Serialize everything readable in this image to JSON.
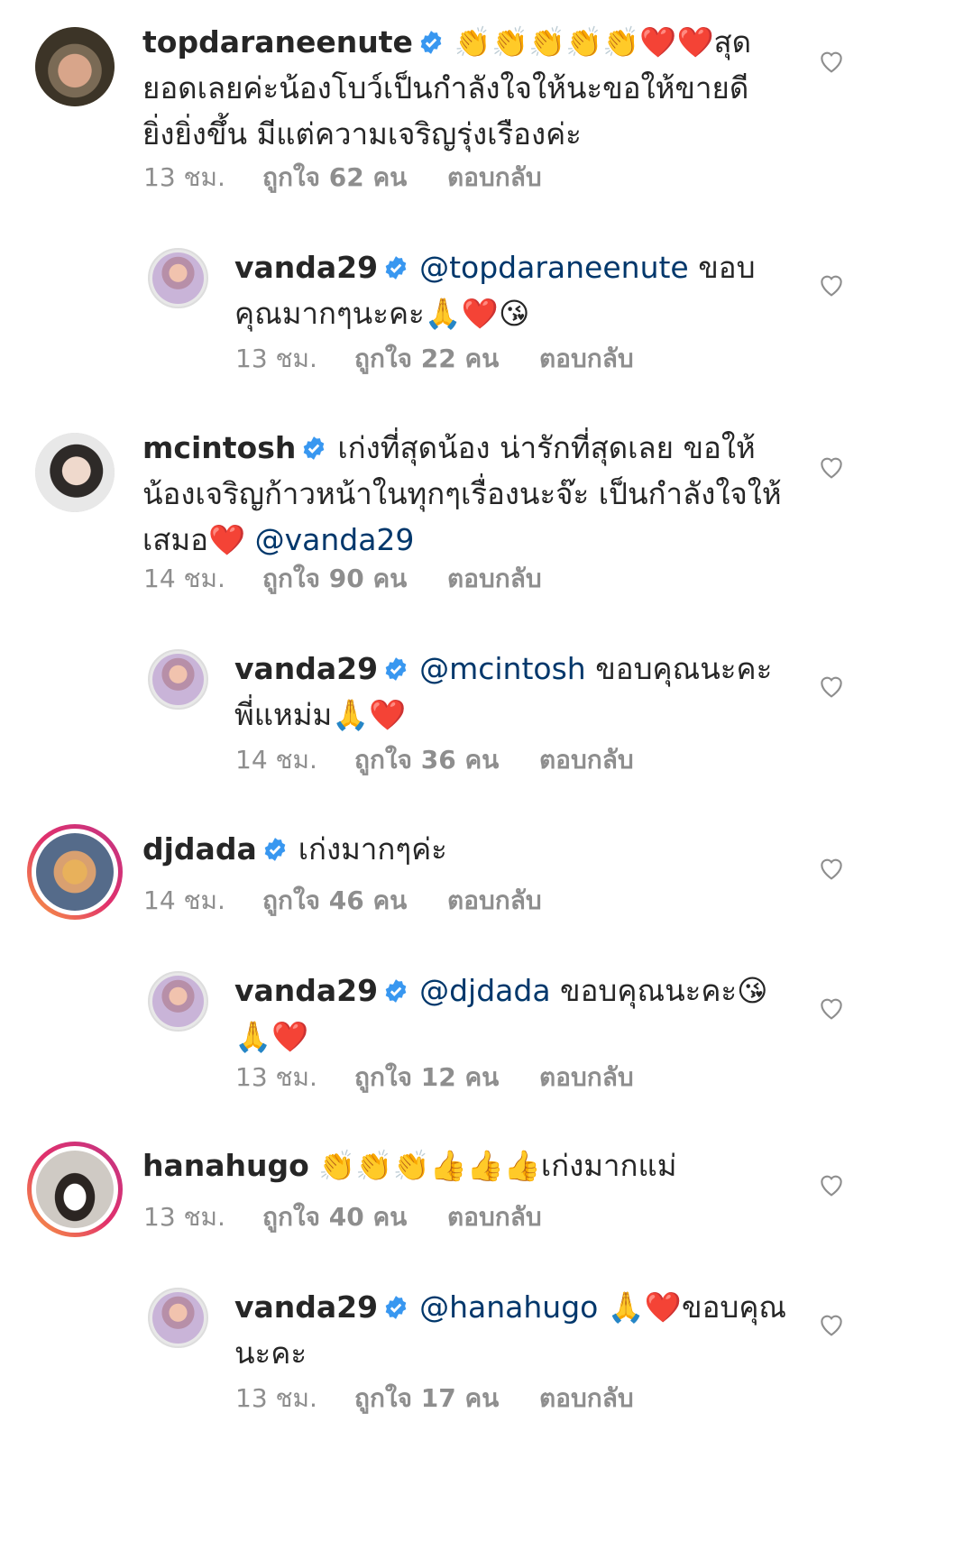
{
  "comments": [
    {
      "username": "topdaraneenute",
      "verified": true,
      "mention": "",
      "text": "👏👏👏👏👏❤️❤️สุดยอดเลยค่ะน้องโบว์เป็นกำลังใจให้นะขอให้ขายดียิ่งยิ่งขึ้น มีแต่ความเจริญรุ่งเรืองค่ะ",
      "time": "13 ชม.",
      "likes": "ถูกใจ 62 คน",
      "reply_label": "ตอบกลับ",
      "is_reply": false
    },
    {
      "username": "vanda29",
      "verified": true,
      "mention": "@topdaraneenute",
      "text": " ขอบคุณมากๆนะคะ🙏❤️😘",
      "time": "13 ชม.",
      "likes": "ถูกใจ 22 คน",
      "reply_label": "ตอบกลับ",
      "is_reply": true
    },
    {
      "username": "mcintosh",
      "verified": true,
      "mention": "",
      "text": "เก่งที่สุดน้อง น่ารักที่สุดเลย ขอให้น้องเจริญก้าวหน้าในทุกๆเรื่องนะจ๊ะ เป็นกำลังใจให้เสมอ❤️ ",
      "trailing_mention": "@vanda29",
      "time": "14 ชม.",
      "likes": "ถูกใจ 90 คน",
      "reply_label": "ตอบกลับ",
      "is_reply": false
    },
    {
      "username": "vanda29",
      "verified": true,
      "mention": "@mcintosh",
      "text": " ขอบคุณนะคะพี่แหม่ม🙏❤️",
      "time": "14 ชม.",
      "likes": "ถูกใจ 36 คน",
      "reply_label": "ตอบกลับ",
      "is_reply": true
    },
    {
      "username": "djdada",
      "verified": true,
      "mention": "",
      "text": "เก่งมากๆค่ะ",
      "time": "14 ชม.",
      "likes": "ถูกใจ 46 คน",
      "reply_label": "ตอบกลับ",
      "is_reply": false
    },
    {
      "username": "vanda29",
      "verified": true,
      "mention": "@djdada",
      "text": " ขอบคุณนะคะ😘🙏❤️",
      "time": "13 ชม.",
      "likes": "ถูกใจ 12 คน",
      "reply_label": "ตอบกลับ",
      "is_reply": true
    },
    {
      "username": "hanahugo",
      "verified": false,
      "mention": "",
      "text": "👏👏👏👍👍👍เก่งมากแม่",
      "time": "13 ชม.",
      "likes": "ถูกใจ 40 คน",
      "reply_label": "ตอบกลับ",
      "is_reply": false
    },
    {
      "username": "vanda29",
      "verified": true,
      "mention": "@hanahugo",
      "text": " 🙏❤️ขอบคุณนะคะ",
      "time": "13 ชม.",
      "likes": "ถูกใจ 17 คน",
      "reply_label": "ตอบกลับ",
      "is_reply": true
    }
  ],
  "colors": {
    "text": "#262626",
    "meta": "#8e8e8e",
    "mention": "#00376b",
    "verified": "#3897f0",
    "heart_outline": "#8e8e8e",
    "story_ring_start": "#f9a03f",
    "story_ring_end": "#c13584"
  },
  "icons": {
    "verified": "verified-badge-icon",
    "like": "heart-outline-icon"
  }
}
